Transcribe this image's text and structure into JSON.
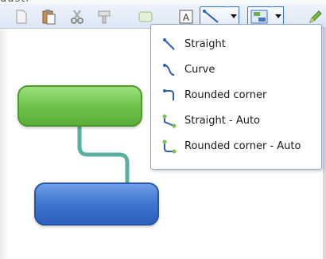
{
  "top_strip_text": "dustl                                               ",
  "toolbar": {
    "buttons": [
      {
        "name": "new-page-icon"
      },
      {
        "name": "paste-icon"
      },
      {
        "name": "cut-icon"
      },
      {
        "name": "format-painter-icon"
      },
      {
        "name": "shape-icon"
      },
      {
        "name": "text-box-icon"
      },
      {
        "name": "connector-icon"
      },
      {
        "name": "layout-icon"
      },
      {
        "name": "pencil-icon"
      }
    ]
  },
  "connector_menu": {
    "items": [
      {
        "label": "Straight",
        "icon": "straight-connector-icon"
      },
      {
        "label": "Curve",
        "icon": "curve-connector-icon"
      },
      {
        "label": "Rounded corner",
        "icon": "rounded-corner-connector-icon"
      },
      {
        "label": "Straight - Auto",
        "icon": "straight-auto-connector-icon"
      },
      {
        "label": "Rounded corner - Auto",
        "icon": "rounded-corner-auto-connector-icon"
      }
    ]
  },
  "colors": {
    "accent": "#3d73c7",
    "green_shape": "#74c651",
    "blue_shape": "#3f74d0",
    "connector_line": "#5ab0a0"
  }
}
